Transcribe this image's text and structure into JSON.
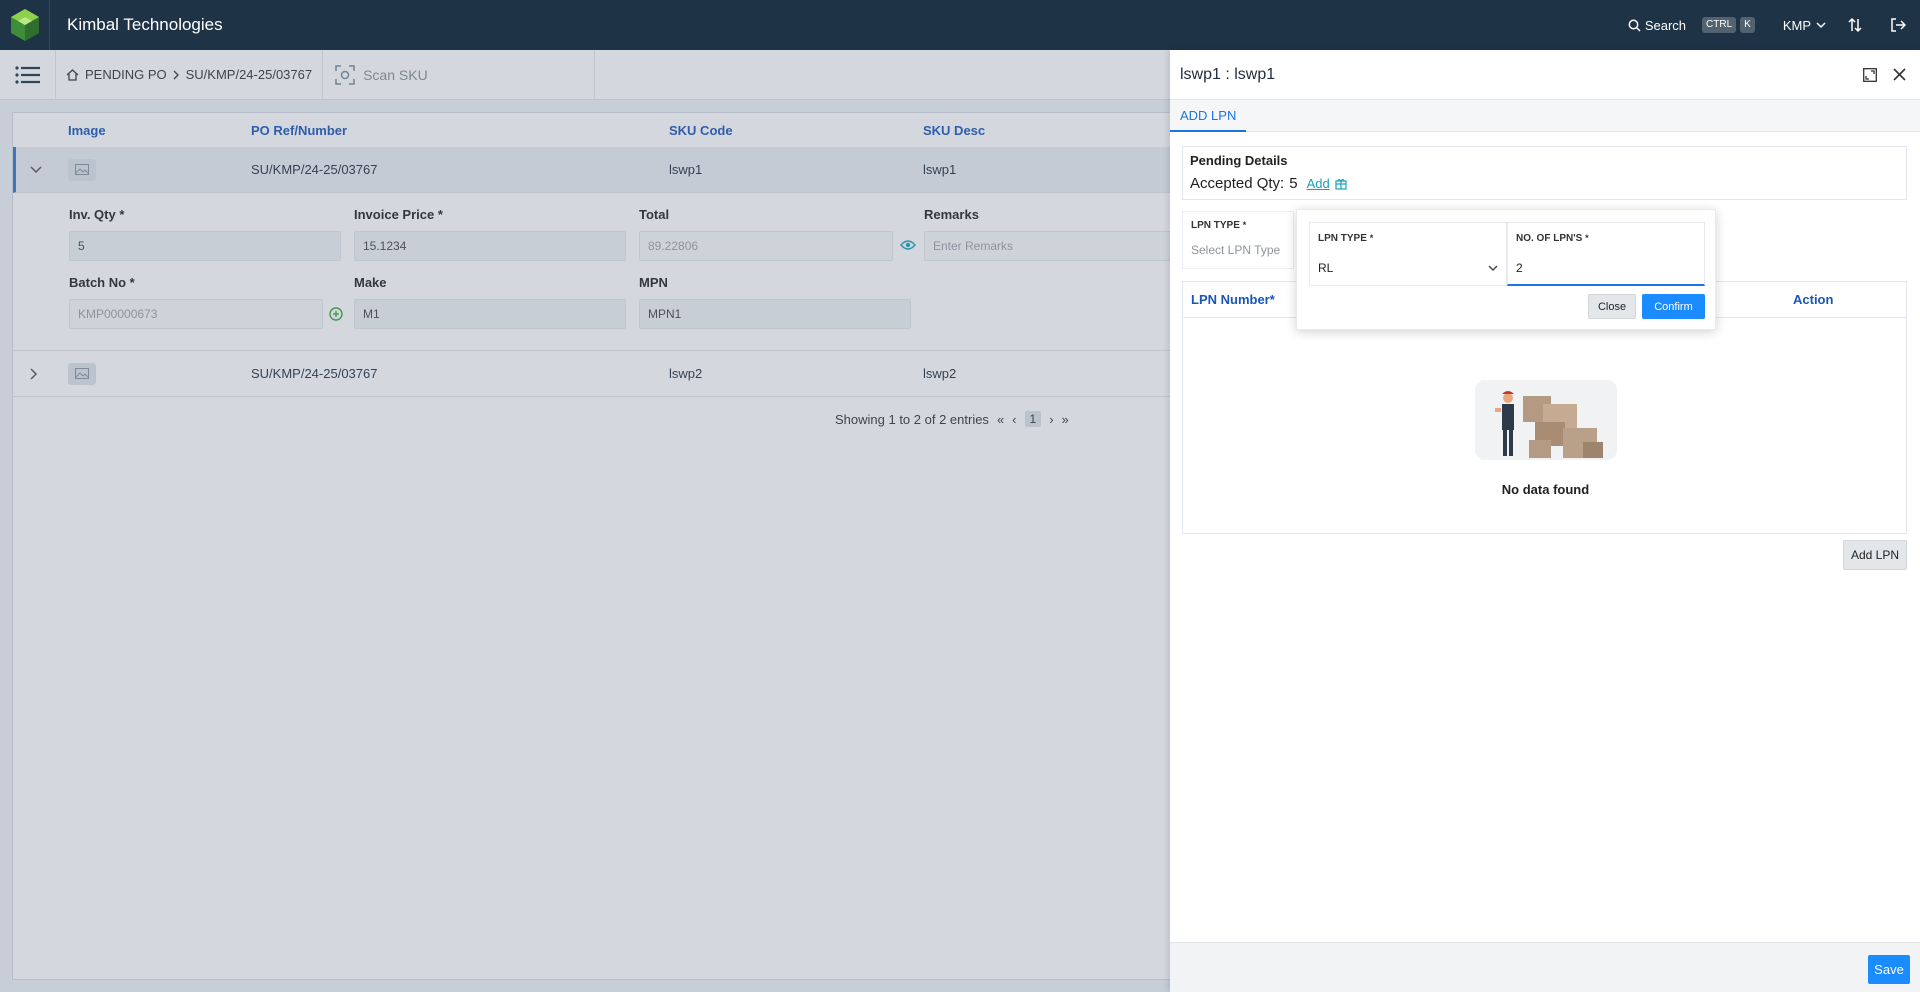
{
  "header": {
    "brand": "Kimbal Technologies",
    "search_label": "Search",
    "shortcut_ctrl": "CTRL",
    "shortcut_key": "K",
    "org": "KMP"
  },
  "breadcrumb": {
    "home": "PENDING PO",
    "current": "SU/KMP/24-25/03767"
  },
  "scan_placeholder": "Scan SKU",
  "table": {
    "columns": [
      "Image",
      "PO Ref/Number",
      "SKU Code",
      "SKU Desc"
    ],
    "rows": [
      {
        "po": "SU/KMP/24-25/03767",
        "sku": "lswp1",
        "desc": "lswp1"
      },
      {
        "po": "SU/KMP/24-25/03767",
        "sku": "lswp2",
        "desc": "lswp2"
      }
    ],
    "detail": {
      "inv_qty_label": "Inv. Qty *",
      "inv_qty": "5",
      "invoice_price_label": "Invoice Price *",
      "invoice_price": "15.1234",
      "total_label": "Total",
      "total": "89.22806",
      "remarks_label": "Remarks",
      "remarks_placeholder": "Enter Remarks",
      "batch_label": "Batch No *",
      "batch_placeholder": "KMP00000673",
      "make_label": "Make",
      "make": "M1",
      "mpn_label": "MPN",
      "mpn": "MPN1"
    },
    "pagination": {
      "summary": "Showing 1 to 2 of 2 entries",
      "page": "1"
    }
  },
  "drawer": {
    "title": "lswp1 : lswp1",
    "tab": "ADD LPN",
    "pending_title": "Pending Details",
    "accepted_label": "Accepted Qty:",
    "accepted_value": "5",
    "add_link": "Add",
    "lpn_type_label": "LPN TYPE",
    "lpn_type_placeholder": "Select LPN Type",
    "col_lpn_number": "LPN Number*",
    "col_action": "Action",
    "empty_text": "No data found",
    "add_lpn_button": "Add LPN",
    "save_button": "Save"
  },
  "popup": {
    "lpn_type_label": "LPN TYPE",
    "lpn_type_value": "RL",
    "no_lpns_label": "NO. OF LPN'S",
    "no_lpns_value": "2",
    "close_button": "Close",
    "confirm_button": "Confirm"
  },
  "colors": {
    "topbar": "#1f3347",
    "accent": "#1a8cff",
    "header_text": "#1a56b8",
    "brand_green": "#6cc04a"
  }
}
